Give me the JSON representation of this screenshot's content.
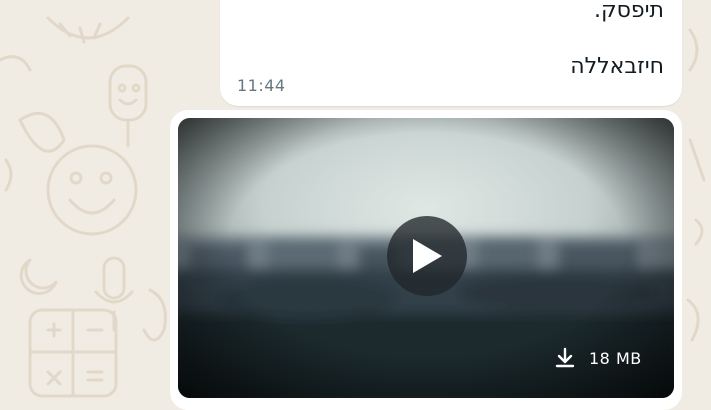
{
  "colors": {
    "chat_background": "#f1ece3",
    "bubble_background": "#ffffff",
    "message_text": "#111b21",
    "timestamp_text": "#667781",
    "overlay_text": "#ffffff"
  },
  "message": {
    "lines": [
      "תיפסק.",
      "חיזבאללה"
    ],
    "time": "11:44"
  },
  "video_message": {
    "play_icon": "play-icon",
    "download_icon": "download-icon",
    "file_size": "18 MB"
  }
}
